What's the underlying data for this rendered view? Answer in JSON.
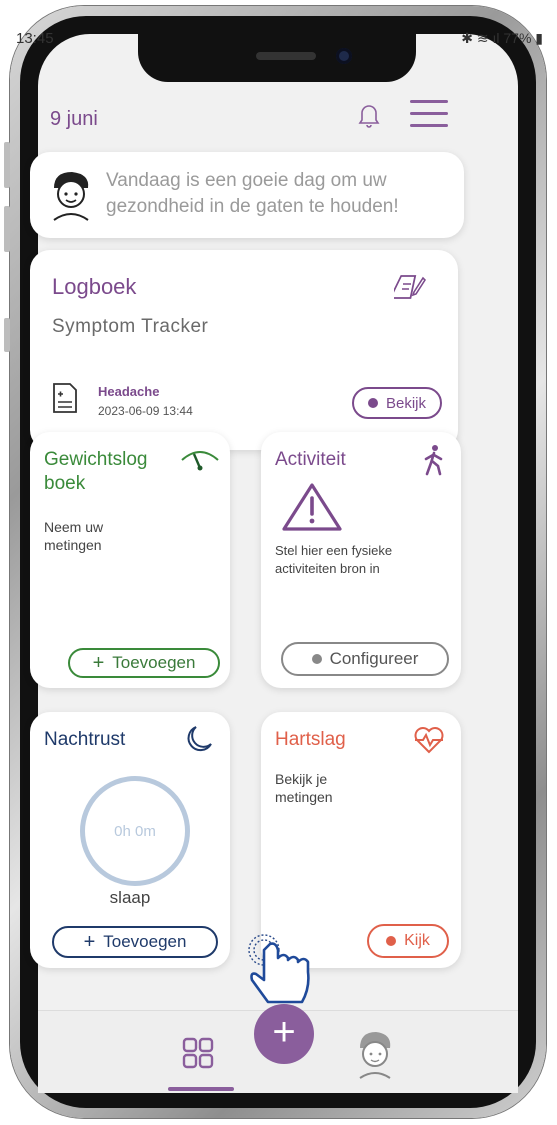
{
  "status": {
    "time": "13:45",
    "battery": "77%"
  },
  "header": {
    "date": "9 juni"
  },
  "message": {
    "text": "Vandaag is een goeie dag om uw gezondheid in de gaten te houden!"
  },
  "logbook": {
    "title": "Logboek",
    "subtitle": "Symptom Tracker",
    "entry_name": "Headache",
    "entry_datetime": "2023-06-09 13:44",
    "view_label": "Bekijk"
  },
  "weight": {
    "title": "Gewichtslog boek",
    "body": "Neem uw metingen",
    "add_label": "Toevoegen"
  },
  "activity": {
    "title": "Activiteit",
    "body": "Stel hier een fysieke activiteiten bron in",
    "configure_label": "Configureer"
  },
  "sleep": {
    "title": "Nachtrust",
    "duration": "0h 0m",
    "caption": "slaap",
    "add_label": "Toevoegen"
  },
  "heart": {
    "title": "Hartslag",
    "body": "Bekijk je metingen",
    "view_label": "Kijk"
  },
  "nav": {
    "add_symbol": "+"
  },
  "colors": {
    "primary": "#8a5e9c",
    "green": "#3a8a3a",
    "navy": "#1f3a6a",
    "coral": "#e0604a"
  },
  "icons": [
    "bell-icon",
    "menu-icon",
    "notepad-edit-icon",
    "document-icon",
    "gauge-icon",
    "walking-icon",
    "warning-icon",
    "moon-icon",
    "heartbeat-icon",
    "grid-icon",
    "avatar-icon",
    "tap-hand-icon"
  ]
}
